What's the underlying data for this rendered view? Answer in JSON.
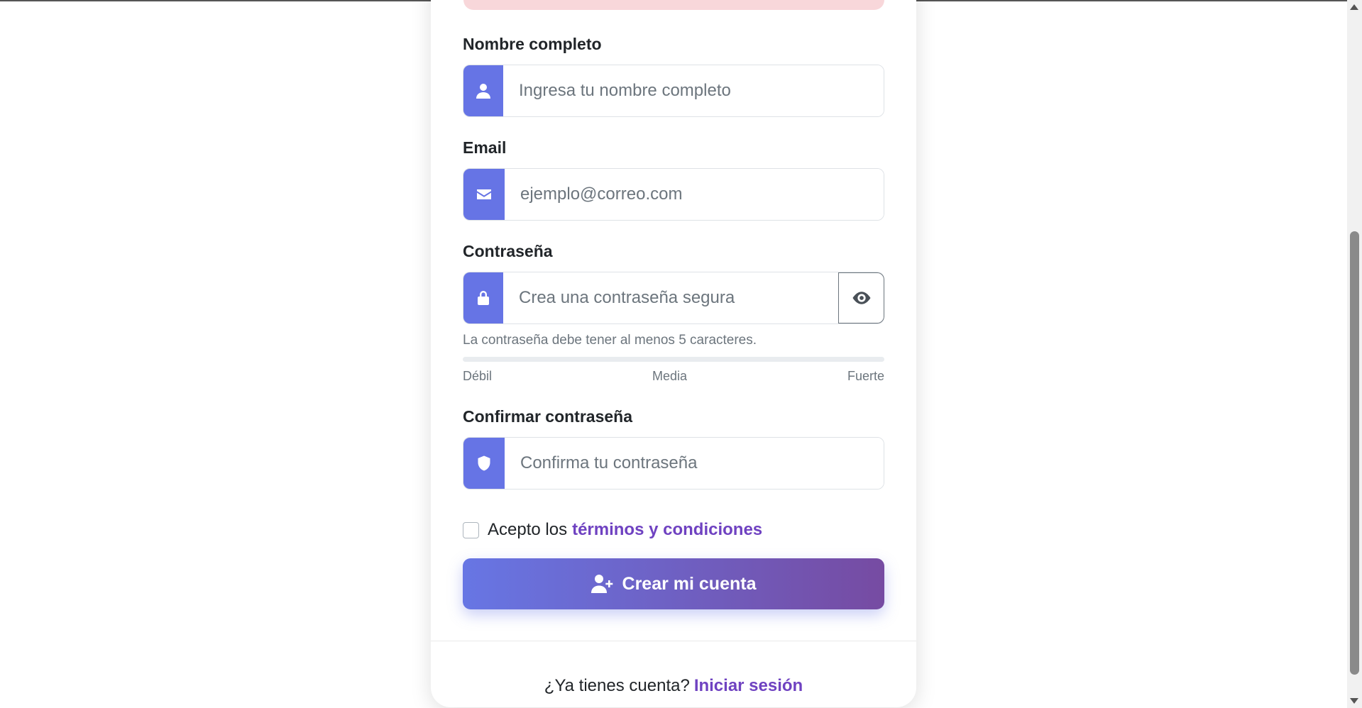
{
  "form": {
    "name": {
      "label": "Nombre completo",
      "placeholder": "Ingresa tu nombre completo",
      "icon": "user-icon"
    },
    "email": {
      "label": "Email",
      "placeholder": "ejemplo@correo.com",
      "icon": "envelope-icon"
    },
    "password": {
      "label": "Contraseña",
      "placeholder": "Crea una contraseña segura",
      "icon": "lock-icon",
      "toggle_icon": "eye-icon",
      "hint": "La contraseña debe tener al menos 5 caracteres.",
      "strength": 0,
      "strength_labels": {
        "weak": "Débil",
        "medium": "Media",
        "strong": "Fuerte"
      }
    },
    "confirm": {
      "label": "Confirmar contraseña",
      "placeholder": "Confirma tu contraseña",
      "icon": "shield-icon"
    },
    "terms": {
      "prefix": "Acepto los",
      "link": "términos y condiciones",
      "checked": false
    },
    "submit": {
      "label": "Crear mi cuenta",
      "icon": "user-plus-icon"
    }
  },
  "footer": {
    "text": "¿Ya tienes cuenta?",
    "link": "Iniciar sesión"
  },
  "colors": {
    "accent": "#6674e5",
    "gradient_end": "#764ba2",
    "link": "#6f42c1",
    "alert_bg": "#f8d7da"
  }
}
